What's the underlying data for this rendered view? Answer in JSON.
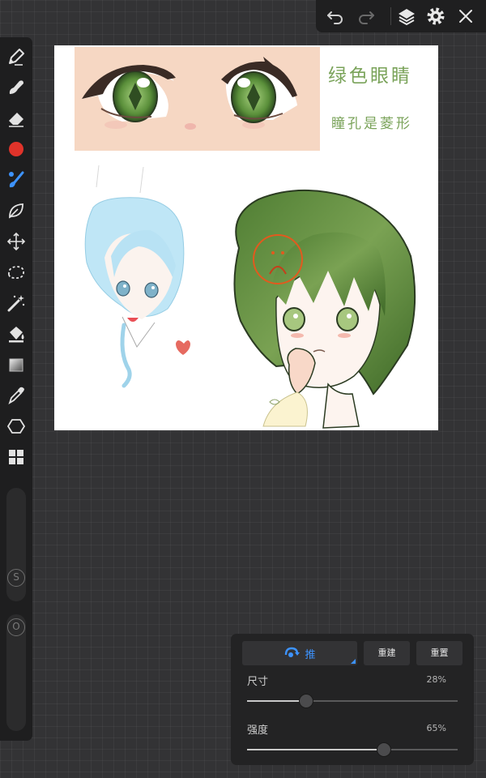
{
  "top_bar": {
    "icons": [
      "undo-icon",
      "redo-icon",
      "layers-icon",
      "settings-icon",
      "close-icon"
    ]
  },
  "toolbar": {
    "tools": [
      "pencil-icon",
      "smudge-icon",
      "eraser-icon",
      "color-swatch",
      "brush-icon",
      "lasso-leaf-icon",
      "move-icon",
      "selection-icon",
      "magic-wand-icon",
      "fill-bucket-icon",
      "gradient-icon",
      "eyedropper-icon",
      "shape-hexagon-icon",
      "grid-icon"
    ],
    "active_tool": "brush-icon",
    "current_color": "#e0332a",
    "size_slider_label": "S",
    "opacity_slider_label": "O"
  },
  "canvas": {
    "title": "绿色眼睛",
    "subtitle": "瞳孔是菱形"
  },
  "brush_panel": {
    "mode_label": "推",
    "rebuild_label": "重建",
    "reset_label": "重置",
    "size_label": "尺寸",
    "size_value": "28%",
    "size_fraction": 0.28,
    "strength_label": "强度",
    "strength_value": "65%",
    "strength_fraction": 0.65
  },
  "colors": {
    "accent": "#3d93ff",
    "green_hair": "#5e8c3d",
    "blue_hair": "#b8e2f4"
  }
}
